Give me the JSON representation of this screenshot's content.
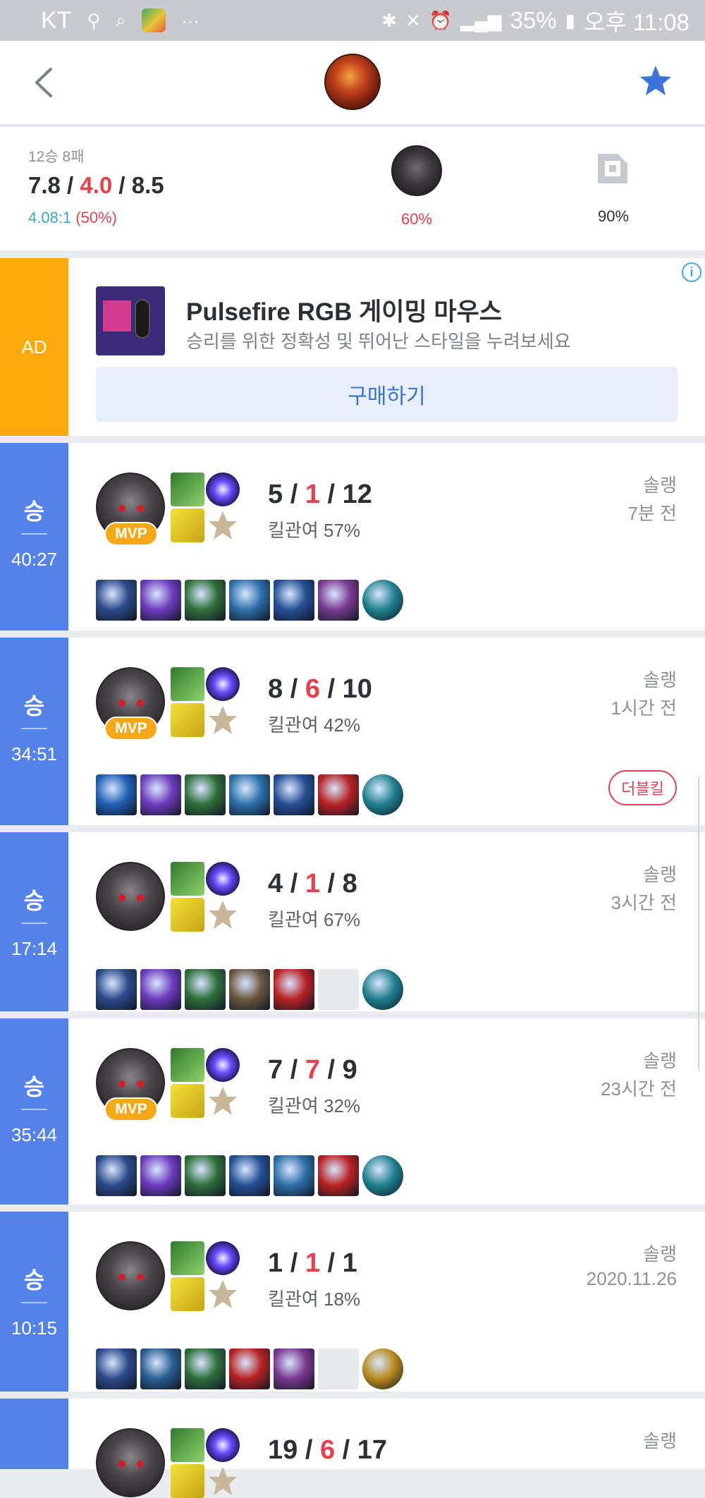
{
  "status_bar": {
    "carrier": "KT",
    "battery": "35%",
    "time": "오후 11:08"
  },
  "header": {
    "back_icon": "chevron-left-icon",
    "favorite_icon": "star-icon",
    "accent": "#3b73d8"
  },
  "summary": {
    "record": "12승 8패",
    "kda_k": "7.8",
    "kda_d": "4.0",
    "kda_a": "8.5",
    "sep": " / ",
    "ratio": "4.08:1",
    "winrate": "(50%)",
    "champion_pct": "60%",
    "position_pct": "90%"
  },
  "ad": {
    "side_label": "AD",
    "title": "Pulsefire RGB 게이밍 마우스",
    "subtitle": "승리를 위한 정확성 및 뛰어난 스타일을 누려보세요",
    "button": "구매하기",
    "info_icon": "i"
  },
  "games": [
    {
      "result": "승",
      "duration": "40:27",
      "mvp": "MVP",
      "k": "5",
      "d": "1",
      "a": "12",
      "kp": "킬관여 57%",
      "queue": "솔랭",
      "ago": "7분 전",
      "badge": ""
    },
    {
      "result": "승",
      "duration": "34:51",
      "mvp": "MVP",
      "k": "8",
      "d": "6",
      "a": "10",
      "kp": "킬관여 42%",
      "queue": "솔랭",
      "ago": "1시간 전",
      "badge": "더블킬"
    },
    {
      "result": "승",
      "duration": "17:14",
      "mvp": "",
      "k": "4",
      "d": "1",
      "a": "8",
      "kp": "킬관여 67%",
      "queue": "솔랭",
      "ago": "3시간 전",
      "badge": ""
    },
    {
      "result": "승",
      "duration": "35:44",
      "mvp": "MVP",
      "k": "7",
      "d": "7",
      "a": "9",
      "kp": "킬관여 32%",
      "queue": "솔랭",
      "ago": "23시간 전",
      "badge": ""
    },
    {
      "result": "승",
      "duration": "10:15",
      "mvp": "",
      "k": "1",
      "d": "1",
      "a": "1",
      "kp": "킬관여 18%",
      "queue": "솔랭",
      "ago": "2020.11.26",
      "badge": ""
    },
    {
      "result": "",
      "duration": "",
      "mvp": "",
      "k": "19",
      "d": "6",
      "a": "17",
      "kp": "",
      "queue": "솔랭",
      "ago": "",
      "badge": ""
    }
  ],
  "colors": {
    "win": "#5383e8",
    "ad": "#fba90c",
    "death": "#e5414e",
    "mvp": "#f4a817"
  }
}
